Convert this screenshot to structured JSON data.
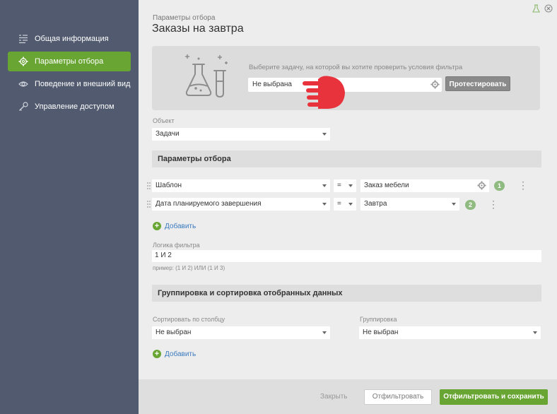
{
  "sidebar": {
    "items": [
      {
        "label": "Общая информация",
        "icon": "list-icon",
        "active": false
      },
      {
        "label": "Параметры отбора",
        "icon": "gear-icon",
        "active": true
      },
      {
        "label": "Поведение и внешний вид",
        "icon": "eye-icon",
        "active": false
      },
      {
        "label": "Управление доступом",
        "icon": "key-icon",
        "active": false
      }
    ]
  },
  "header": {
    "subtitle": "Параметры отбора",
    "title": "Заказы на завтра"
  },
  "test": {
    "hint": "Выберите задачу, на которой вы хотите проверить условия фильтра",
    "task_value": "Не выбрана",
    "button": "Протестировать"
  },
  "object": {
    "label": "Объект",
    "value": "Задачи"
  },
  "filter": {
    "section_title": "Параметры отбора",
    "rows": [
      {
        "field": "Шаблон",
        "operator": "=",
        "value": "Заказ мебели",
        "num": "1"
      },
      {
        "field": "Дата планируемого завершения",
        "operator": "=",
        "value": "Завтра",
        "num": "2"
      }
    ],
    "add": "Добавить",
    "logic_label": "Логика фильтра",
    "logic_value": "1 И 2",
    "logic_example": "пример: (1 И 2) ИЛИ (1 И 3)"
  },
  "grouping": {
    "section_title": "Группировка и сортировка отобранных данных",
    "sort_label": "Сортировать по столбцу",
    "sort_value": "Не выбран",
    "group_label": "Группировка",
    "group_value": "Не выбран",
    "add": "Добавить"
  },
  "footer": {
    "close": "Закрыть",
    "filter": "Отфильтровать",
    "save": "Отфильтровать и сохранить"
  },
  "colors": {
    "accent": "#68a532",
    "sidebar": "#515a6e",
    "link": "#3a7abf",
    "pointer": "#e8323c"
  }
}
